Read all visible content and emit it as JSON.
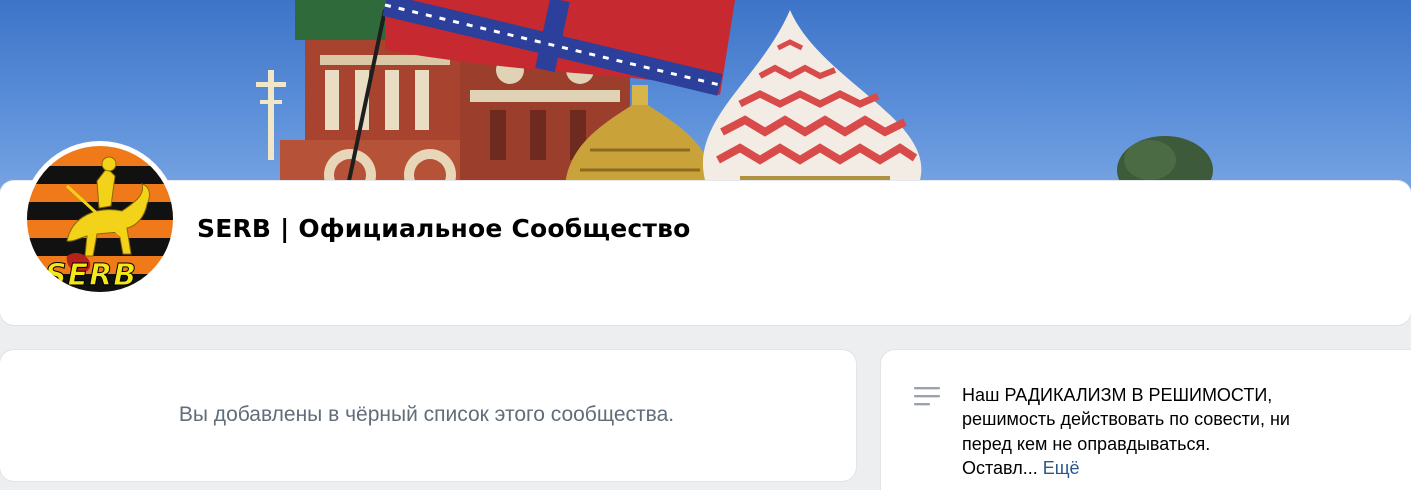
{
  "group": {
    "title": "SERB | Официальное Сообщество",
    "avatar_text": "SERB"
  },
  "blacklist": {
    "message": "Вы добавлены в чёрный список этого сообщества."
  },
  "description": {
    "lines": [
      "Наш РАДИКАЛИЗМ В РЕШИМОСТИ,",
      "решимость действовать по совести, ни",
      "перед кем не оправдываться."
    ],
    "truncated": "Оставл...",
    "more_label": "Ещё"
  },
  "colors": {
    "page_bg": "#edeef0",
    "link": "#2a5885",
    "muted_text": "#626d7a"
  },
  "icons": {
    "description": "text-lines-icon"
  }
}
